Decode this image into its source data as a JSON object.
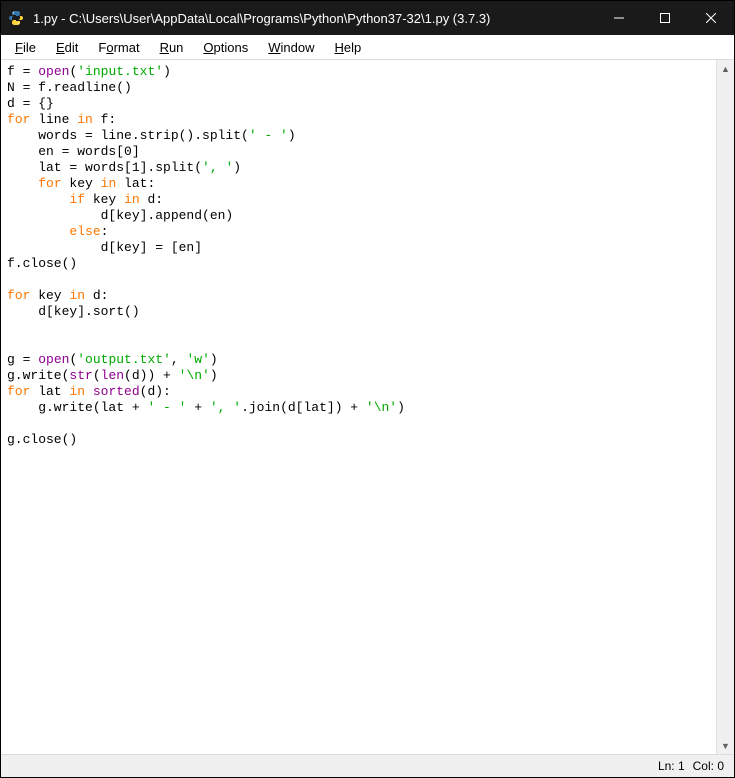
{
  "title": "1.py - C:\\Users\\User\\AppData\\Local\\Programs\\Python\\Python37-32\\1.py (3.7.3)",
  "menu": {
    "file": "File",
    "edit": "Edit",
    "format": "Format",
    "run": "Run",
    "options": "Options",
    "window": "Window",
    "help": "Help"
  },
  "status": {
    "ln_label": "Ln: 1",
    "col_label": "Col: 0"
  },
  "code": {
    "l1_a": "f = ",
    "l1_open": "open",
    "l1_b": "(",
    "l1_s": "'input.txt'",
    "l1_c": ")",
    "l2": "N = f.readline()",
    "l3": "d = {}",
    "l4_for": "for",
    "l4_a": " line ",
    "l4_in": "in",
    "l4_b": " f:",
    "l5": "    words = line.strip().split(",
    "l5_s": "' - '",
    "l5_b": ")",
    "l6": "    en = words[0]",
    "l7": "    lat = words[1].split(",
    "l7_s": "', '",
    "l7_b": ")",
    "l8_sp": "    ",
    "l8_for": "for",
    "l8_a": " key ",
    "l8_in": "in",
    "l8_b": " lat:",
    "l9_sp": "        ",
    "l9_if": "if",
    "l9_a": " key ",
    "l9_in": "in",
    "l9_b": " d:",
    "l10": "            d[key].append(en)",
    "l11_sp": "        ",
    "l11_else": "else",
    "l11_b": ":",
    "l12": "            d[key] = [en]",
    "l13": "f.close()",
    "l15_for": "for",
    "l15_a": " key ",
    "l15_in": "in",
    "l15_b": " d:",
    "l16": "    d[key].sort()",
    "l19_a": "g = ",
    "l19_open": "open",
    "l19_b": "(",
    "l19_s1": "'output.txt'",
    "l19_c": ", ",
    "l19_s2": "'w'",
    "l19_d": ")",
    "l20_a": "g.write(",
    "l20_str": "str",
    "l20_b": "(",
    "l20_len": "len",
    "l20_c": "(d)) + ",
    "l20_s": "'\\n'",
    "l20_d": ")",
    "l21_for": "for",
    "l21_a": " lat ",
    "l21_in": "in",
    "l21_sp": " ",
    "l21_sorted": "sorted",
    "l21_b": "(d):",
    "l22_a": "    g.write(lat + ",
    "l22_s1": "' - '",
    "l22_b": " + ",
    "l22_s2": "', '",
    "l22_c": ".join(d[lat]) + ",
    "l22_s3": "'\\n'",
    "l22_d": ")",
    "l24": "g.close()"
  }
}
